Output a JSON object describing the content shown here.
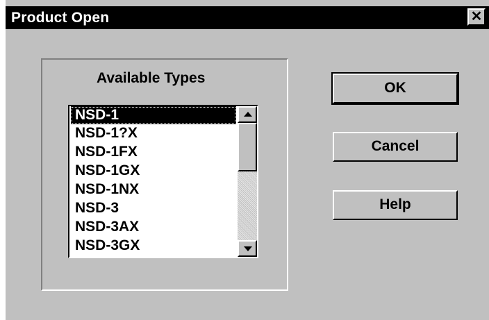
{
  "window": {
    "title": "Product Open",
    "close_glyph": "✕"
  },
  "group": {
    "label": "Available Types"
  },
  "list": {
    "items": [
      "NSD-1",
      "NSD-1?X",
      "NSD-1FX",
      "NSD-1GX",
      "NSD-1NX",
      "NSD-3",
      "NSD-3AX",
      "NSD-3GX"
    ],
    "selected_index": 0
  },
  "buttons": {
    "ok": "OK",
    "cancel": "Cancel",
    "help": "Help"
  },
  "colors": {
    "face": "#c0c0c0",
    "titlebar": "#000000",
    "title_text": "#ffffff",
    "selection": "#000000"
  },
  "icons": {
    "close": "close-icon",
    "scroll_up": "arrow-up-icon",
    "scroll_down": "arrow-down-icon"
  }
}
